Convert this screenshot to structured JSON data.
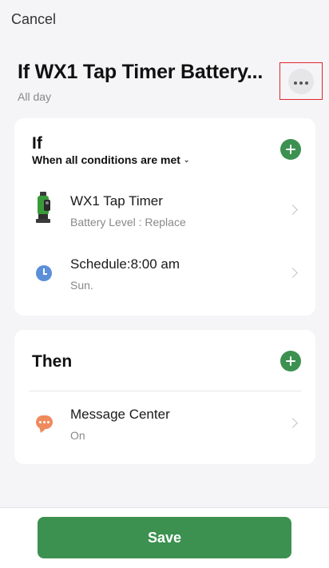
{
  "header": {
    "cancel_label": "Cancel",
    "title": "If WX1 Tap Timer Battery...",
    "subtitle": "All day"
  },
  "if_section": {
    "title": "If",
    "condition_mode": "When all conditions are met",
    "conditions": [
      {
        "title": "WX1 Tap Timer",
        "detail": "Battery Level : Replace",
        "icon": "tap-timer-device-icon"
      },
      {
        "title": "Schedule:8:00 am",
        "detail": "Sun.",
        "icon": "clock-icon"
      }
    ]
  },
  "then_section": {
    "title": "Then",
    "actions": [
      {
        "title": "Message Center",
        "detail": "On",
        "icon": "message-bubble-icon"
      }
    ]
  },
  "footer": {
    "save_label": "Save"
  },
  "colors": {
    "accent_green": "#3c9150",
    "highlight_red": "#e0242b",
    "clock_blue": "#5b8fd8",
    "message_orange": "#ef8a5d"
  }
}
